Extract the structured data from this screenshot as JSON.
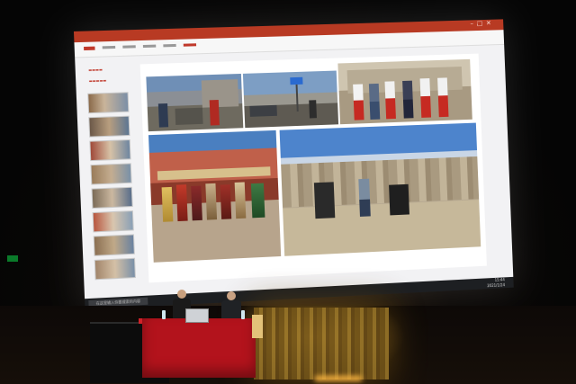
{
  "scene": {
    "description_label": "",
    "colors": {
      "titlebar": "#b83a23",
      "table_cloth": "#b3131c",
      "curtain": "#a07b2a",
      "taskbar": "#1d1f22"
    }
  },
  "powerpoint": {
    "title": "",
    "ribbon_tabs": [
      "",
      "",
      "",
      "",
      "",
      "",
      "",
      "",
      "",
      ""
    ],
    "thumbnail_count": 9,
    "taskbar": {
      "search_placeholder": "在这里输入你要搜索的内容",
      "time": "15:44",
      "date": "2021/1/24"
    }
  },
  "slide_photos": [
    {
      "subject": "group in front of stone building",
      "icon": "photo-icon"
    },
    {
      "subject": "street sign and vehicles",
      "icon": "photo-icon"
    },
    {
      "subject": "group of men in white caps",
      "icon": "photo-icon"
    },
    {
      "subject": "people in traditional dress before temple",
      "icon": "photo-icon"
    },
    {
      "subject": "men crouching before canyon cliffs",
      "icon": "photo-icon"
    }
  ]
}
